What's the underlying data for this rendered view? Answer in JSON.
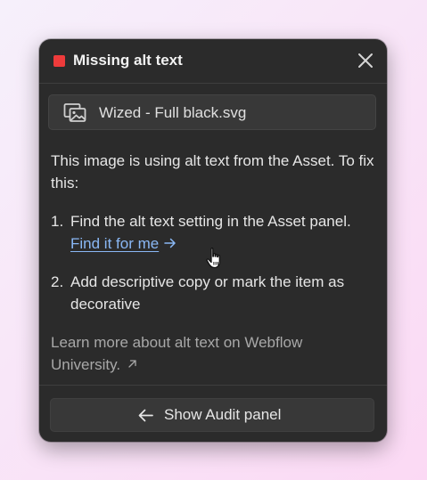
{
  "panel": {
    "title": "Missing alt text",
    "status_color": "#ee3b3b",
    "close_icon": "close-icon"
  },
  "asset": {
    "icon": "image-icon",
    "name": "Wized - Full black.svg"
  },
  "intro": "This image is using alt text from the Asset. To fix this:",
  "steps": [
    {
      "number": "1.",
      "text": "Find the alt text setting in the Asset panel.",
      "link_label": "Find it for me",
      "link_icon": "arrow-right-icon"
    },
    {
      "number": "2.",
      "text": "Add descriptive copy or mark the item as decorative"
    }
  ],
  "learn_more": {
    "text": "Learn more about alt text on Webflow University.",
    "icon": "external-link-icon"
  },
  "footer": {
    "button_label": "Show Audit panel",
    "button_icon": "arrow-left-icon"
  },
  "colors": {
    "panel_bg": "#2b2b2b",
    "link": "#8ab8f5",
    "muted_text": "#a8a8a8"
  }
}
